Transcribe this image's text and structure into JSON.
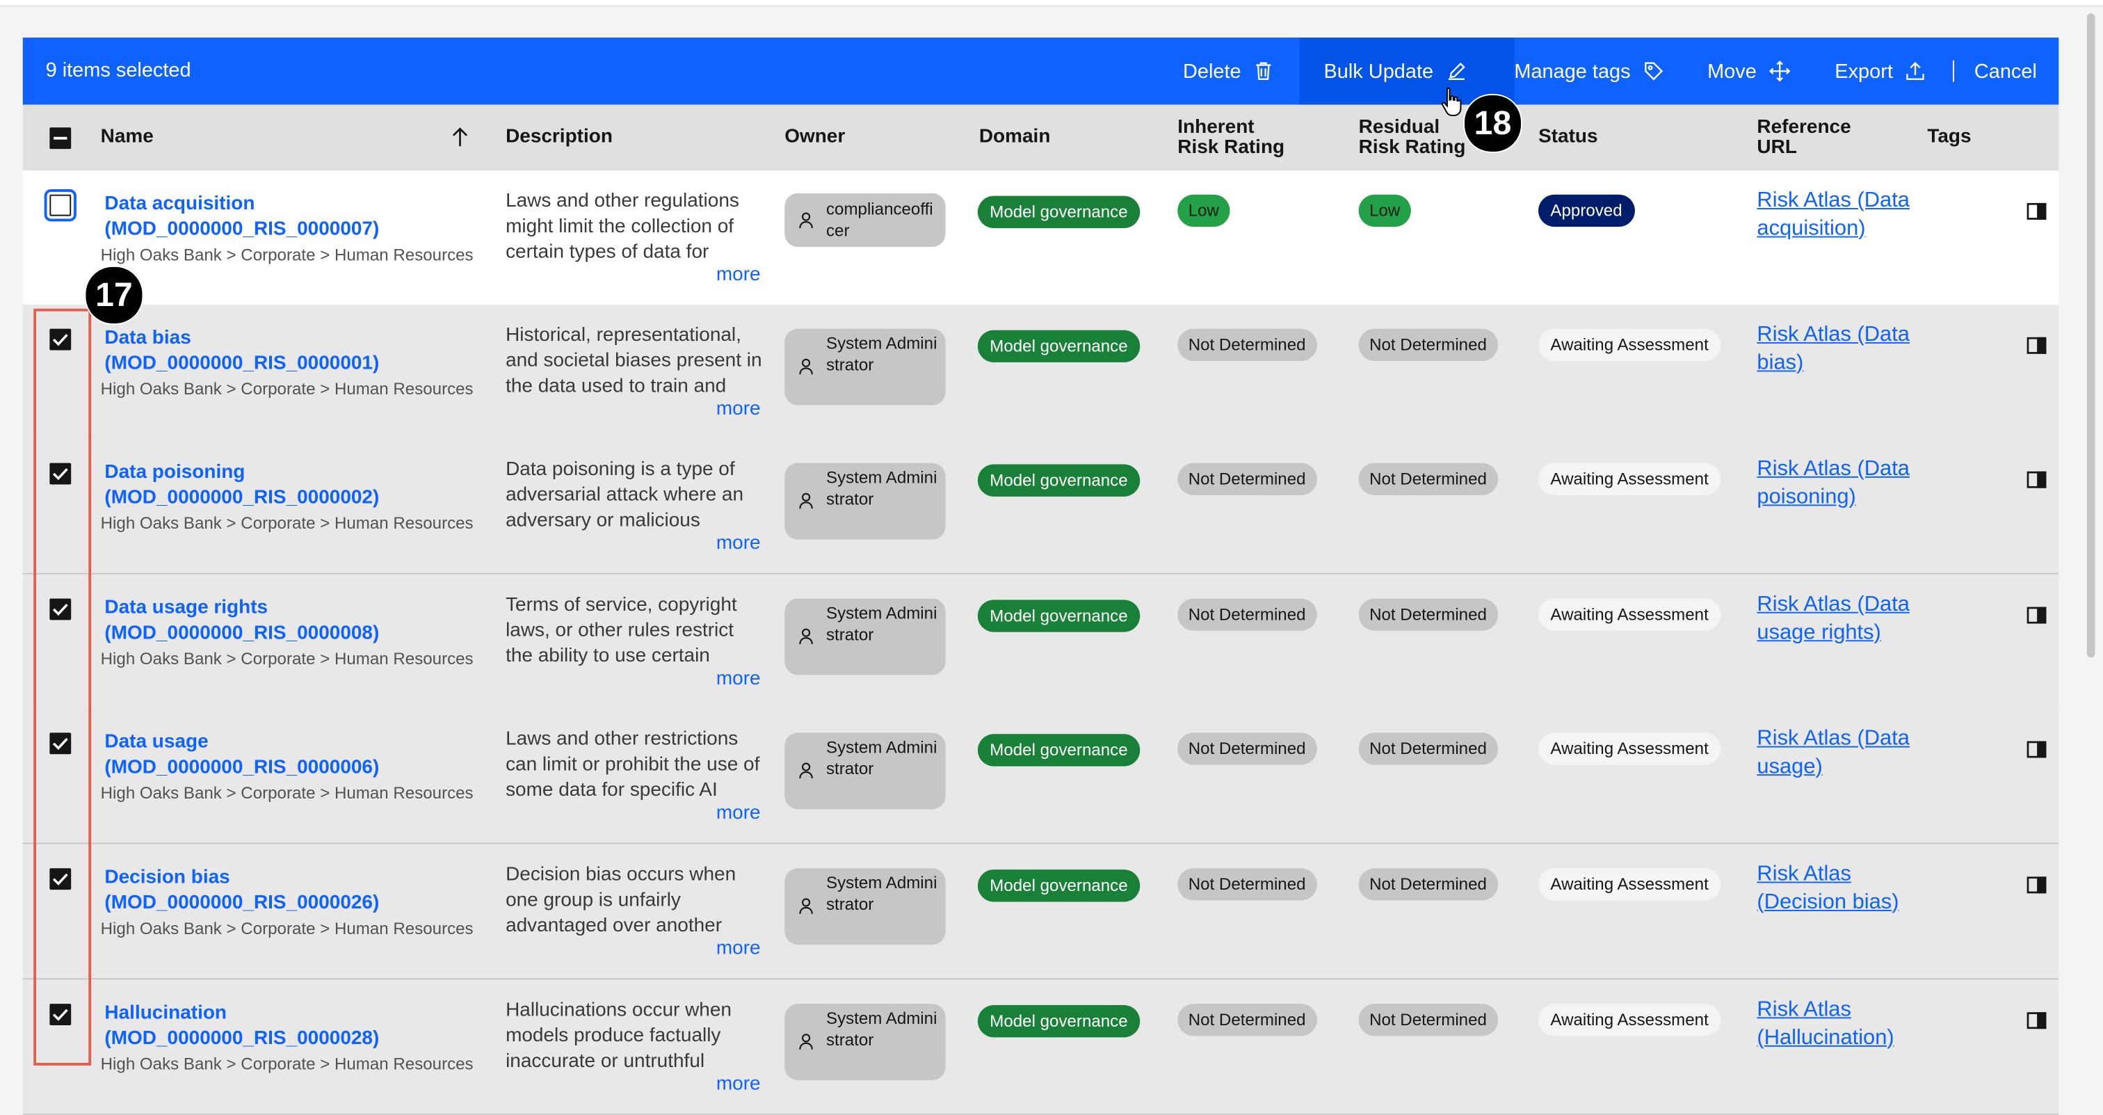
{
  "selection_bar": {
    "count_label": "9 items selected",
    "actions": {
      "delete": "Delete",
      "bulk_update": "Bulk Update",
      "manage_tags": "Manage tags",
      "move": "Move",
      "export": "Export",
      "cancel": "Cancel"
    },
    "icons": [
      "trash-icon",
      "edit-icon",
      "tag-icon",
      "move-icon",
      "upload-icon"
    ]
  },
  "columns": {
    "name": "Name",
    "description": "Description",
    "owner": "Owner",
    "domain": "Domain",
    "inherent_1": "Inherent",
    "inherent_2": "Risk Rating",
    "residual_1": "Residual",
    "residual_2": "Risk Rating",
    "status": "Status",
    "reference_1": "Reference",
    "reference_2": "URL",
    "tags": "Tags"
  },
  "rows": [
    {
      "checked": false,
      "name_1": "Data acquisition",
      "name_2": "(MOD_0000000_RIS_0000007)",
      "path": "High Oaks Bank > Corporate > Human Resources",
      "description": "Laws and other regulations might limit the collection of certain types of data for",
      "more": "more",
      "owner": "complianceofficer",
      "domain": "Model governance",
      "inherent": "Low",
      "residual": "Low",
      "status": "Approved",
      "reference": "Risk Atlas (Data acquisition)"
    },
    {
      "checked": true,
      "name_1": "Data bias",
      "name_2": "(MOD_0000000_RIS_0000001)",
      "path": "High Oaks Bank > Corporate > Human Resources",
      "description": "Historical, representational, and societal biases present in the data used to train and",
      "more": "more",
      "owner": "System Administrator",
      "domain": "Model governance",
      "inherent": "Not Determined",
      "residual": "Not Determined",
      "status": "Awaiting Assessment",
      "reference": "Risk Atlas (Data bias)"
    },
    {
      "checked": true,
      "name_1": "Data poisoning",
      "name_2": "(MOD_0000000_RIS_0000002)",
      "path": "High Oaks Bank > Corporate > Human Resources",
      "description": "Data poisoning is a type of adversarial attack where an adversary or malicious",
      "more": "more",
      "owner": "System Administrator",
      "domain": "Model governance",
      "inherent": "Not Determined",
      "residual": "Not Determined",
      "status": "Awaiting Assessment",
      "reference": "Risk Atlas (Data poisoning)"
    },
    {
      "checked": true,
      "name_1": "Data usage rights",
      "name_2": "(MOD_0000000_RIS_0000008)",
      "path": "High Oaks Bank > Corporate > Human Resources",
      "description": "Terms of service, copyright laws, or other rules restrict the ability to use certain",
      "more": "more",
      "owner": "System Administrator",
      "domain": "Model governance",
      "inherent": "Not Determined",
      "residual": "Not Determined",
      "status": "Awaiting Assessment",
      "reference": "Risk Atlas (Data usage rights)"
    },
    {
      "checked": true,
      "name_1": "Data usage",
      "name_2": "(MOD_0000000_RIS_0000006)",
      "path": "High Oaks Bank > Corporate > Human Resources",
      "description": "Laws and other restrictions can limit or prohibit the use of some data for specific AI",
      "more": "more",
      "owner": "System Administrator",
      "domain": "Model governance",
      "inherent": "Not Determined",
      "residual": "Not Determined",
      "status": "Awaiting Assessment",
      "reference": "Risk Atlas (Data usage)"
    },
    {
      "checked": true,
      "name_1": "Decision bias",
      "name_2": "(MOD_0000000_RIS_0000026)",
      "path": "High Oaks Bank > Corporate > Human Resources",
      "description": "Decision bias occurs when one group is unfairly advantaged over another",
      "more": "more",
      "owner": "System Administrator",
      "domain": "Model governance",
      "inherent": "Not Determined",
      "residual": "Not Determined",
      "status": "Awaiting Assessment",
      "reference": "Risk Atlas (Decision bias)"
    },
    {
      "checked": true,
      "name_1": "Hallucination",
      "name_2": "(MOD_0000000_RIS_0000028)",
      "path": "High Oaks Bank > Corporate > Human Resources",
      "description": "Hallucinations occur when models produce factually inaccurate or untruthful",
      "more": "more",
      "owner": "System Administrator",
      "domain": "Model governance",
      "inherent": "Not Determined",
      "residual": "Not Determined",
      "status": "Awaiting Assessment",
      "reference": "Risk Atlas (Hallucination)"
    }
  ],
  "annotations": {
    "step_a": "17",
    "step_b": "18"
  },
  "colors": {
    "selection_bar": "#0f62fe",
    "selection_bar_active": "#0353e9",
    "link": "#0f62fe",
    "domain_tag": "#198038",
    "low_tag": "#24a148",
    "approved_tag": "#001d6c",
    "annotation_box": "#e0604e"
  }
}
